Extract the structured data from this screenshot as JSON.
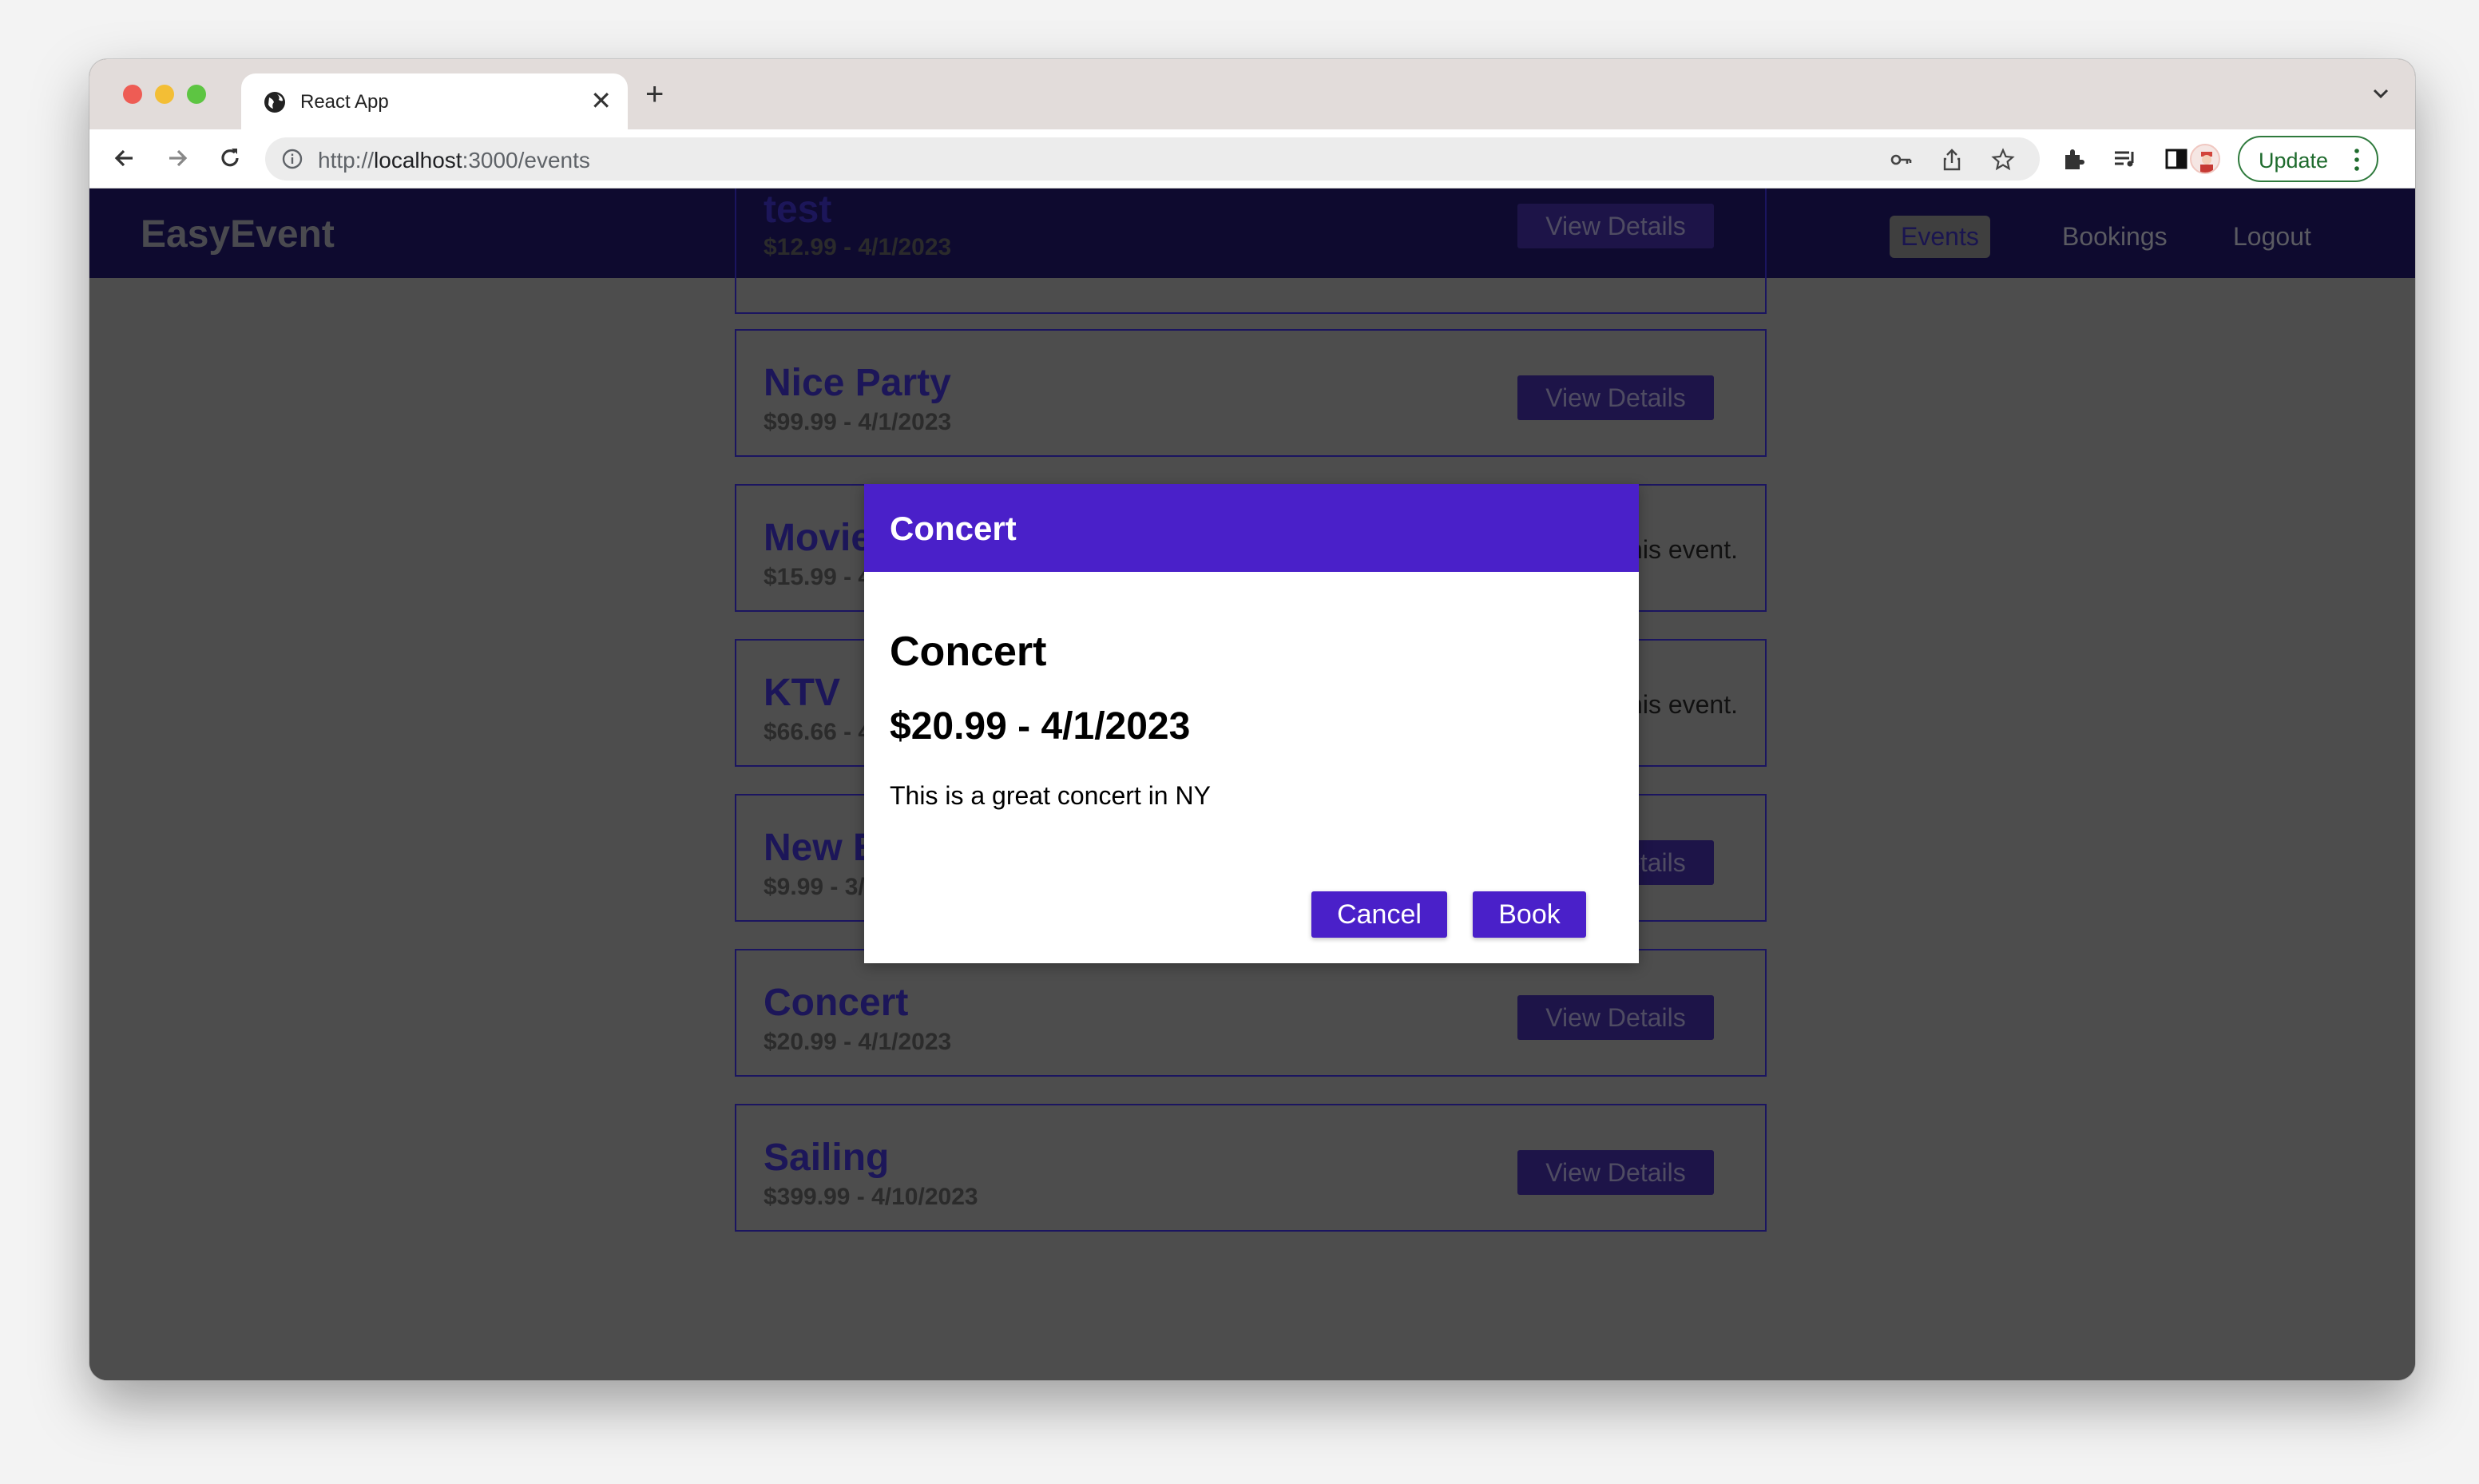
{
  "browser": {
    "tab_title": "React App",
    "new_tab_symbol": "+",
    "close_symbol": "✕",
    "url_scheme": "http://",
    "url_host": "localhost",
    "url_rest": ":3000/events",
    "update_label": "Update"
  },
  "app": {
    "brand": "EasyEvent",
    "nav": {
      "events": "Events",
      "bookings": "Bookings",
      "logout": "Logout"
    }
  },
  "events": [
    {
      "title": "test",
      "meta": "$12.99 - 4/1/2023",
      "action": "View Details"
    },
    {
      "title": "Nice Party",
      "meta": "$99.99 - 4/1/2023",
      "action": "View Details"
    },
    {
      "title": "Movie",
      "meta": "$15.99 - 4/1/2023",
      "owner_note": "You are the owner of this event."
    },
    {
      "title": "KTV",
      "meta": "$66.66 - 4/1/2023",
      "owner_note": "You are the owner of this event."
    },
    {
      "title": "New Event",
      "meta": "$9.99 - 3/26/2023",
      "action": "View Details"
    },
    {
      "title": "Concert",
      "meta": "$20.99 - 4/1/2023",
      "action": "View Details"
    },
    {
      "title": "Sailing",
      "meta": "$399.99 - 4/10/2023",
      "action": "View Details"
    }
  ],
  "modal": {
    "header": "Concert",
    "title": "Concert",
    "price_date": "$20.99 - 4/1/2023",
    "description": "This is a great concert in NY",
    "cancel_label": "Cancel",
    "book_label": "Book"
  },
  "colors": {
    "accent": "#4a20c9",
    "navbar": "#0e0a2f",
    "overlay": "#4d4d4d"
  }
}
